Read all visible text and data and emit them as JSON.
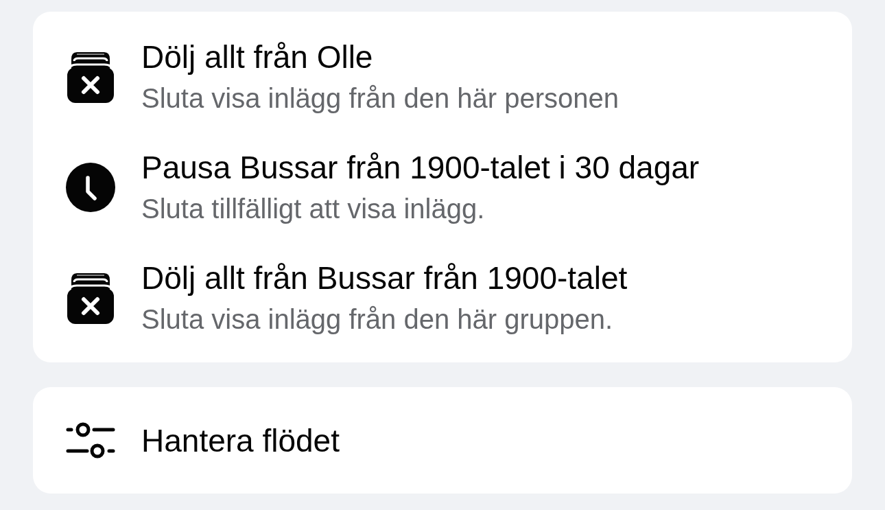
{
  "sections": [
    {
      "items": [
        {
          "kind": "hide",
          "title": "Dölj allt från Olle",
          "subtitle": "Sluta visa inlägg från den här personen"
        },
        {
          "kind": "snooze",
          "title": "Pausa Bussar från 1900-talet i 30 dagar",
          "subtitle": "Sluta tillfälligt att visa inlägg."
        },
        {
          "kind": "hide",
          "title": "Dölj allt från Bussar från 1900-talet",
          "subtitle": "Sluta visa inlägg från den här gruppen."
        }
      ]
    },
    {
      "items": [
        {
          "kind": "manage",
          "title": "Hantera flödet"
        }
      ]
    }
  ]
}
